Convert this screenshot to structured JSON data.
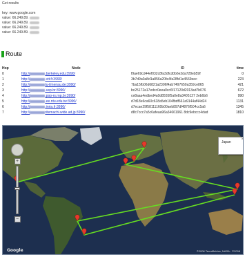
{
  "results": {
    "title": "Get results",
    "key_label": "key:",
    "key_value": "www.google.com",
    "values": [
      {
        "label": "value:",
        "text": "66.249.89."
      },
      {
        "label": "value:",
        "text": "66.249.89."
      },
      {
        "label": "value:",
        "text": "66.249.89."
      },
      {
        "label": "value:",
        "text": "66.249.89."
      }
    ]
  },
  "route": {
    "title": "Route",
    "columns": {
      "hop": "Hop",
      "node": "Node",
      "id": "ID",
      "time": "time"
    },
    "rows": [
      {
        "hop": "0",
        "prefix": "http://",
        "suffix": ".berkeley.edu:3990/",
        "id": "f9ae69cd44ef032c8fa3dfcd0b6e2da728eb59f",
        "time": "0"
      },
      {
        "hop": "1",
        "prefix": "http://",
        "suffix": ".vtt.fi:3990/",
        "id": "3b7d9a0a8d1a856a20fe4fa28fd1e4569eec",
        "time": "223"
      },
      {
        "hop": "2",
        "prefix": "http://",
        "suffix": "tu-ilmenau.de:3990/",
        "id": "7ba15fb06d6821a2306f4ab7497650a359ce865",
        "time": "421"
      },
      {
        "hop": "3",
        "prefix": "http://",
        "suffix": ".usp.br:3990/",
        "id": "bc25172a17edcc0eea0cc6f17120d2013ad7b076",
        "time": "672"
      },
      {
        "hop": "4",
        "prefix": "http://",
        "suffix": ".pop-rs.rnp.br:3990/",
        "id": "ce8aaa4edbed4a0d8555f5a0e8a3405127 2eb6b6",
        "time": "990"
      },
      {
        "hop": "5",
        "prefix": "http://",
        "suffix": ".ee.ntu.edu.tw:3990/",
        "id": "d7d18e6ca60c618a5eb104fbdf661a9144af44d24",
        "time": "1131"
      },
      {
        "hop": "6",
        "prefix": "http://",
        "suffix": ".inria.fr:3990/",
        "id": "d7ecae29f58111160b00aeb897df4876f504cc5a6",
        "time": "1345"
      },
      {
        "hop": "7",
        "prefix": "http://",
        "suffix": "ritemachi.wide.ad.jp:3990/",
        "id": "d8c7ccc7a5c6afeaa96a34661961 8dc9ebccc4dad",
        "time": "1810"
      }
    ]
  },
  "map": {
    "tooltip_text": "Japan",
    "tooltip_close": "×",
    "copyright": "©2008 TerraMetrics, NASA - ©2008",
    "logo": "Google",
    "route_color": "#66dd22",
    "marker_color": "#e8382b",
    "ocean_color": "#1d2f4f",
    "land_color": "#5b6a3a"
  }
}
